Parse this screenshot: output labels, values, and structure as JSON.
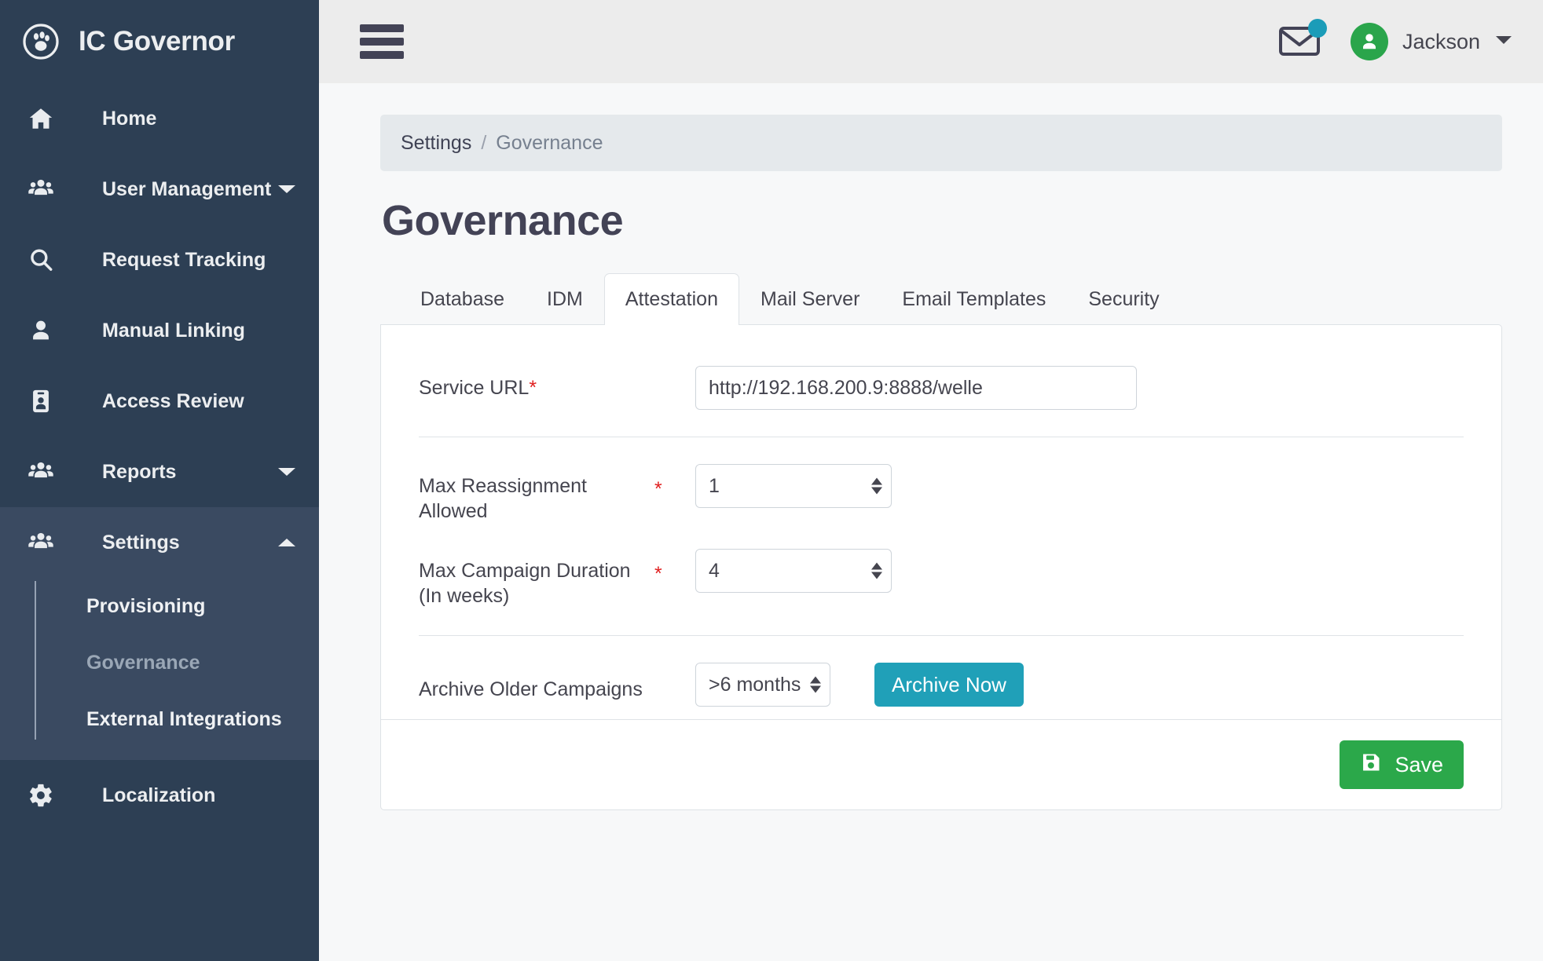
{
  "brand": {
    "title": "IC Governor",
    "logo_icon": "paw-circle-icon"
  },
  "sidebar": {
    "items": [
      {
        "label": "Home",
        "icon": "home-icon",
        "has_caret": false
      },
      {
        "label": "User Management",
        "icon": "users-icon",
        "has_caret": true,
        "caret": "down"
      },
      {
        "label": "Request Tracking",
        "icon": "search-icon",
        "has_caret": false
      },
      {
        "label": "Manual Linking",
        "icon": "user-icon",
        "has_caret": false
      },
      {
        "label": "Access Review",
        "icon": "id-badge-icon",
        "has_caret": false
      },
      {
        "label": "Reports",
        "icon": "users-icon",
        "has_caret": true,
        "caret": "down"
      },
      {
        "label": "Settings",
        "icon": "users-icon",
        "has_caret": true,
        "caret": "up",
        "expanded": true
      },
      {
        "label": "Localization",
        "icon": "gear-icon",
        "has_caret": false
      }
    ],
    "settings_submenu": [
      {
        "label": "Provisioning",
        "current": false
      },
      {
        "label": "Governance",
        "current": true
      },
      {
        "label": "External Integrations",
        "current": false
      }
    ]
  },
  "topbar": {
    "menu_icon": "hamburger-icon",
    "mail_icon": "envelope-icon",
    "mail_badge_color": "#1b9cb8",
    "avatar_icon": "user-avatar-icon",
    "avatar_color": "#2aa54b",
    "user_name": "Jackson",
    "user_caret_icon": "chevron-down-icon"
  },
  "breadcrumb": {
    "root": "Settings",
    "separator": "/",
    "current": "Governance"
  },
  "page": {
    "title": "Governance"
  },
  "tabs": [
    {
      "label": "Database",
      "active": false
    },
    {
      "label": "IDM",
      "active": false
    },
    {
      "label": "Attestation",
      "active": true
    },
    {
      "label": "Mail Server",
      "active": false
    },
    {
      "label": "Email Templates",
      "active": false
    },
    {
      "label": "Security",
      "active": false
    }
  ],
  "form": {
    "service_url": {
      "label": "Service URL",
      "required_mark": "*",
      "value": "http://192.168.200.9:8888/welle"
    },
    "max_reassignment": {
      "label": "Max Reassignment Allowed",
      "required_mark": "*",
      "value": "1"
    },
    "max_campaign_duration": {
      "label": "Max Campaign Duration (In weeks)",
      "required_mark": "*",
      "value": "4"
    },
    "archive": {
      "label": "Archive Older Campaigns",
      "selected_option": ">6 months",
      "button_label": "Archive Now",
      "button_color": "#20a0b8"
    },
    "save": {
      "label": "Save",
      "icon": "floppy-save-icon",
      "color": "#2ba84a"
    }
  }
}
